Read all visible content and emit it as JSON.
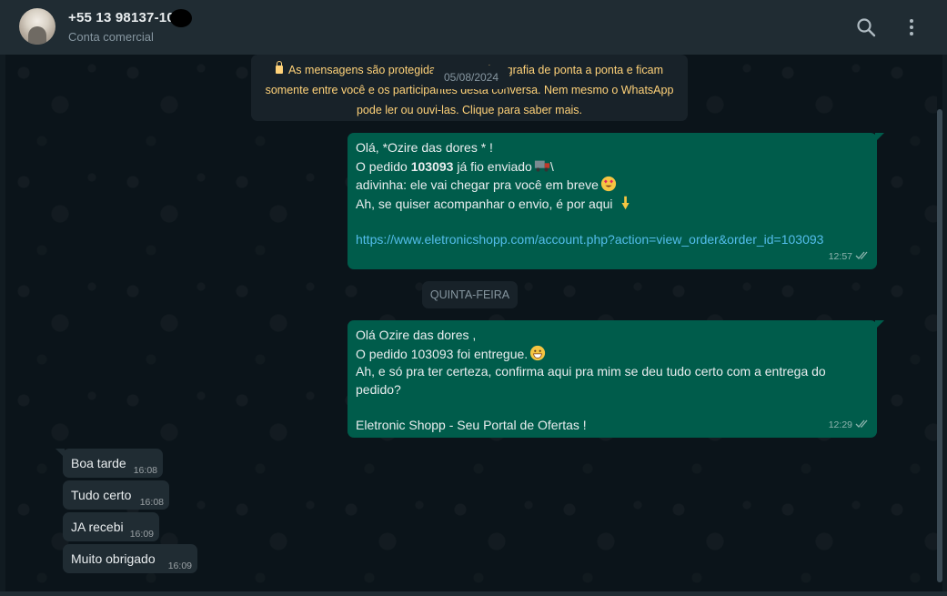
{
  "header": {
    "contact_name": "+55 13 98137-10",
    "subtitle": "Conta comercial",
    "icons": [
      "search-icon",
      "menu-icon"
    ]
  },
  "notice": {
    "line1": "As mensagens são protegidas com a criptografia de ponta a ponta e ficam",
    "line2": "somente entre você e os participantes desta conversa. Nem mesmo o WhatsApp",
    "line3": "pode ler ou ouvi-las. Clique para saber mais."
  },
  "date_chip": "05/08/2024",
  "day_chip": "QUINTA-FEIRA",
  "messages": {
    "m1": {
      "line1": "Olá, *Ozire das dores * !",
      "line2_pre": "O pedido ",
      "line2_bold": "103093",
      "line2_post": " já fio enviado",
      "line2_tail": "\\",
      "line3": "adivinha: ele vai chegar pra você em breve",
      "line4": "Ah, se quiser acompanhar o envio, é por aqui",
      "link": "https://www.eletronicshopp.com/account.php?action=view_order&order_id=103093",
      "time": "12:57"
    },
    "m2": {
      "line1": "Olá Ozire das dores ,",
      "line2": "O pedido 103093 foi entregue.",
      "line3": "Ah, e só pra ter certeza, confirma aqui pra mim se deu tudo certo com a entrega do pedido?",
      "line4": "Eletronic Shopp - Seu Portal de Ofertas !",
      "time": "12:29"
    },
    "incoming": [
      {
        "text": "Boa tarde",
        "time": "16:08"
      },
      {
        "text": "Tudo certo",
        "time": "16:08"
      },
      {
        "text": "JA recebi",
        "time": "16:09"
      },
      {
        "text": "Muito obrigado",
        "time": "16:09"
      }
    ]
  },
  "colors": {
    "outgoing_bubble": "#005c4b",
    "incoming_bubble": "#202c33",
    "header_bg": "#202c33",
    "notice_text": "#ffd279",
    "link": "#53bdeb"
  }
}
